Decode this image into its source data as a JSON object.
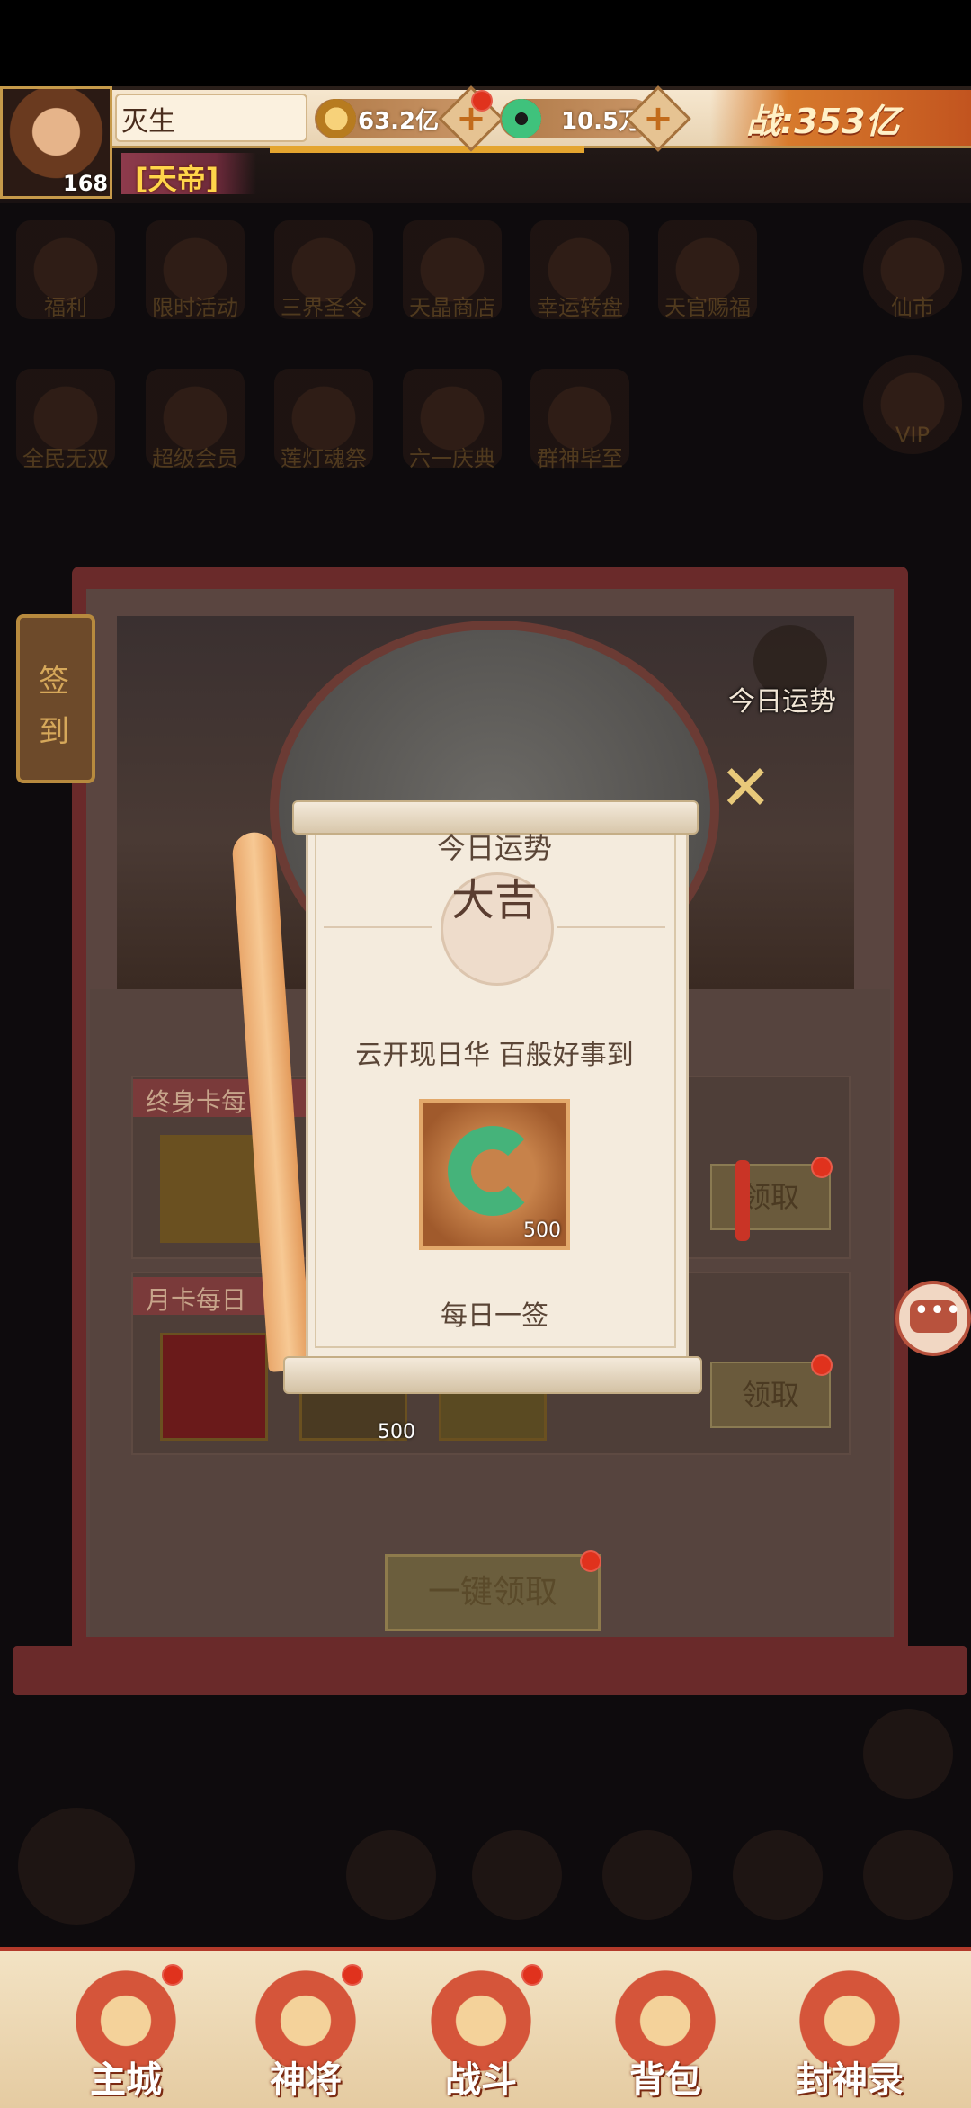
{
  "hud": {
    "player_name": "灭生",
    "level": "168",
    "title": "[天帝]",
    "coins": "63.2亿",
    "jade": "10.5万",
    "power": "战:353亿"
  },
  "bg_icons": [
    {
      "label": "福利"
    },
    {
      "label": "限时活动"
    },
    {
      "label": "三界圣令"
    },
    {
      "label": "天晶商店"
    },
    {
      "label": "幸运转盘"
    },
    {
      "label": "天官赐福"
    },
    {
      "label": "仙市"
    },
    {
      "label": "全民无双"
    },
    {
      "label": "超级会员"
    },
    {
      "label": "莲灯魂祭"
    },
    {
      "label": "六一庆典"
    },
    {
      "label": "群神毕至"
    },
    {
      "label": "VIP"
    }
  ],
  "signin": {
    "tag": "签到",
    "today_fortune_label": "今日运势",
    "row1_title": "终身卡每",
    "row2_title": "月卡每日",
    "claim": "领取",
    "one_key": "一键领取",
    "row2_item_count": "500"
  },
  "popup": {
    "title": "今日运势",
    "fortune": "大吉",
    "description": "云开现日华  百般好事到",
    "reward_count": "500",
    "footer": "每日一签"
  },
  "nav": {
    "items": [
      {
        "label": "主城"
      },
      {
        "label": "神将"
      },
      {
        "label": "战斗"
      },
      {
        "label": "背包"
      },
      {
        "label": "封神录"
      }
    ]
  },
  "colors": {
    "accent_red": "#c93426",
    "gold": "#ffd54a",
    "jade": "#45b37a"
  }
}
